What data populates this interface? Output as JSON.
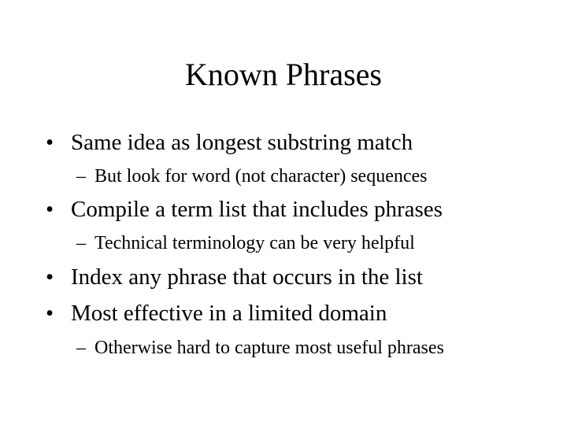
{
  "slide": {
    "title": "Known Phrases",
    "bullet_marker": "•",
    "sub_marker": "–",
    "items": [
      {
        "level": 1,
        "text": "Same idea as longest substring match"
      },
      {
        "level": 2,
        "text": "But look for word (not character) sequences"
      },
      {
        "level": 1,
        "text": "Compile a term list that includes phrases"
      },
      {
        "level": 2,
        "text": "Technical terminology can be very helpful"
      },
      {
        "level": 1,
        "text": "Index any phrase that occurs in the list"
      },
      {
        "level": 1,
        "text": "Most effective in a limited domain"
      },
      {
        "level": 2,
        "text": "Otherwise hard to capture most useful phrases"
      }
    ]
  }
}
